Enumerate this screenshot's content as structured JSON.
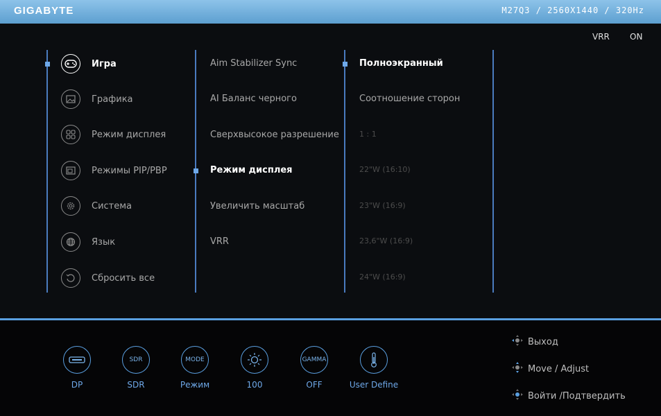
{
  "header": {
    "brand": "GIGABYTE",
    "model_info": "M27Q3 / 2560X1440 / 320Hz"
  },
  "status": {
    "vrr_label": "VRR",
    "vrr_value": "ON"
  },
  "main_menu": [
    {
      "label": "Игра",
      "icon": "gamepad-icon",
      "active": true
    },
    {
      "label": "Графика",
      "icon": "picture-icon",
      "active": false
    },
    {
      "label": "Режим дисплея",
      "icon": "display-mode-icon",
      "active": false
    },
    {
      "label": "Режимы PIP/PBP",
      "icon": "pip-icon",
      "active": false
    },
    {
      "label": "Система",
      "icon": "gear-icon",
      "active": false
    },
    {
      "label": "Язык",
      "icon": "globe-icon",
      "active": false
    },
    {
      "label": "Сбросить все",
      "icon": "reset-icon",
      "active": false
    }
  ],
  "submenu": [
    {
      "label": "Aim Stabilizer Sync"
    },
    {
      "label": "AI Баланс черного"
    },
    {
      "label": "Сверхвысокое разрешение"
    },
    {
      "label": "Режим дисплея",
      "active": true
    },
    {
      "label": "Увеличить масштаб"
    },
    {
      "label": "VRR"
    }
  ],
  "options": [
    {
      "label": "Полноэкранный",
      "active": true
    },
    {
      "label": "Соотношение сторон"
    },
    {
      "label": "1 : 1",
      "dim": true
    },
    {
      "label": "22\"W (16:10)",
      "dim": true
    },
    {
      "label": "23\"W (16:9)",
      "dim": true
    },
    {
      "label": "23,6\"W (16:9)",
      "dim": true
    },
    {
      "label": "24\"W (16:9)",
      "dim": true
    }
  ],
  "status_bar": [
    {
      "icon": "input-port-icon",
      "label": "DP"
    },
    {
      "icon": "sdr-icon",
      "icon_text": "SDR",
      "label": "SDR"
    },
    {
      "icon": "mode-icon",
      "icon_text": "MODE",
      "label": "Режим"
    },
    {
      "icon": "brightness-icon",
      "label": "100"
    },
    {
      "icon": "gamma-icon",
      "icon_text": "GAMMA",
      "label": "OFF"
    },
    {
      "icon": "thermometer-icon",
      "label": "User Define"
    }
  ],
  "help": [
    {
      "icon": "joystick-left-icon",
      "label": "Выход"
    },
    {
      "icon": "joystick-updown-icon",
      "label": "Move / Adjust"
    },
    {
      "icon": "joystick-press-icon",
      "label": "Войти /Подтвердить"
    }
  ],
  "colors": {
    "accent": "#5a9fe0",
    "topbar": "#7fb6e2"
  }
}
